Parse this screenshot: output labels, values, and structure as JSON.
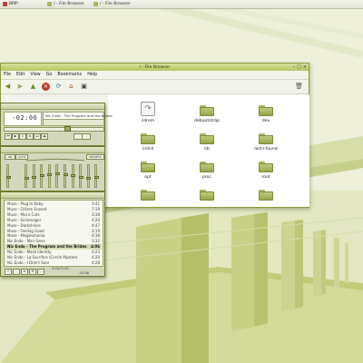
{
  "colors": {
    "accent": "#b7c760",
    "wallpaper": "#e9ecd2",
    "folder": "#a8b55f"
  },
  "taskbar": {
    "items": [
      {
        "label": "BMP",
        "icon": "app-icon"
      },
      {
        "label": "/ - File Browser",
        "icon": "folder-icon"
      },
      {
        "label": "/ - File Browser",
        "icon": "folder-icon"
      }
    ]
  },
  "file_browser": {
    "title": "/ - File Browser",
    "menu": [
      "File",
      "Edit",
      "View",
      "Go",
      "Bookmarks",
      "Help"
    ],
    "toolbar_icons": [
      "back-icon",
      "forward-icon",
      "up-icon",
      "stop-icon",
      "reload-icon",
      "home-icon",
      "computer-icon",
      "trash-icon"
    ],
    "items": [
      "cdrom",
      "debootstrap",
      "dev",
      "initrd",
      "lib",
      "lost+found",
      "opt",
      "proc",
      "root",
      "",
      "",
      ""
    ]
  },
  "player": {
    "time": "-02:06",
    "marquee": "Nic Endo - The Program and the Brides",
    "buttons": [
      "⏮",
      "▶",
      "⏸",
      "⏹",
      "⏭",
      "⏏"
    ]
  },
  "equalizer": {
    "buttons": {
      "on": "ON",
      "auto": "AUTO",
      "presets": "PRESETS"
    },
    "preamp": 0.5,
    "bands": [
      0.55,
      0.5,
      0.45,
      0.4,
      0.35,
      0.4,
      0.45,
      0.5,
      0.55,
      0.5
    ]
  },
  "playlist": {
    "tracks": [
      {
        "title": "Muse - Plug In Baby",
        "length": "3:41"
      },
      {
        "title": "Muse - Citizen Erased",
        "length": "7:19"
      },
      {
        "title": "Muse - Micro Cuts",
        "length": "3:38"
      },
      {
        "title": "Muse - Screenager",
        "length": "4:20"
      },
      {
        "title": "Muse - Darkshines",
        "length": "4:47"
      },
      {
        "title": "Muse - Feeling Good",
        "length": "3:19"
      },
      {
        "title": "Muse - Megalomania",
        "length": "4:38"
      },
      {
        "title": "Nic Endo - Man Gene",
        "length": "3:32"
      },
      {
        "title": "Nic Endo - The Program and the Brides",
        "length": "4:06"
      },
      {
        "title": "Nic Endo - Mask Identity",
        "length": "4:23"
      },
      {
        "title": "Nic Endo - La Sacrifice (Cercle Mystere",
        "length": "4:20"
      },
      {
        "title": "Nic Endo - I Didn't Sear",
        "length": "4:28"
      }
    ],
    "current_index": 8,
    "selected_index": 8,
    "time_top": "4:06/71:09",
    "time_bottom": "-02:06",
    "buttons": [
      "+",
      "-",
      "≡",
      "☰",
      "…"
    ]
  }
}
